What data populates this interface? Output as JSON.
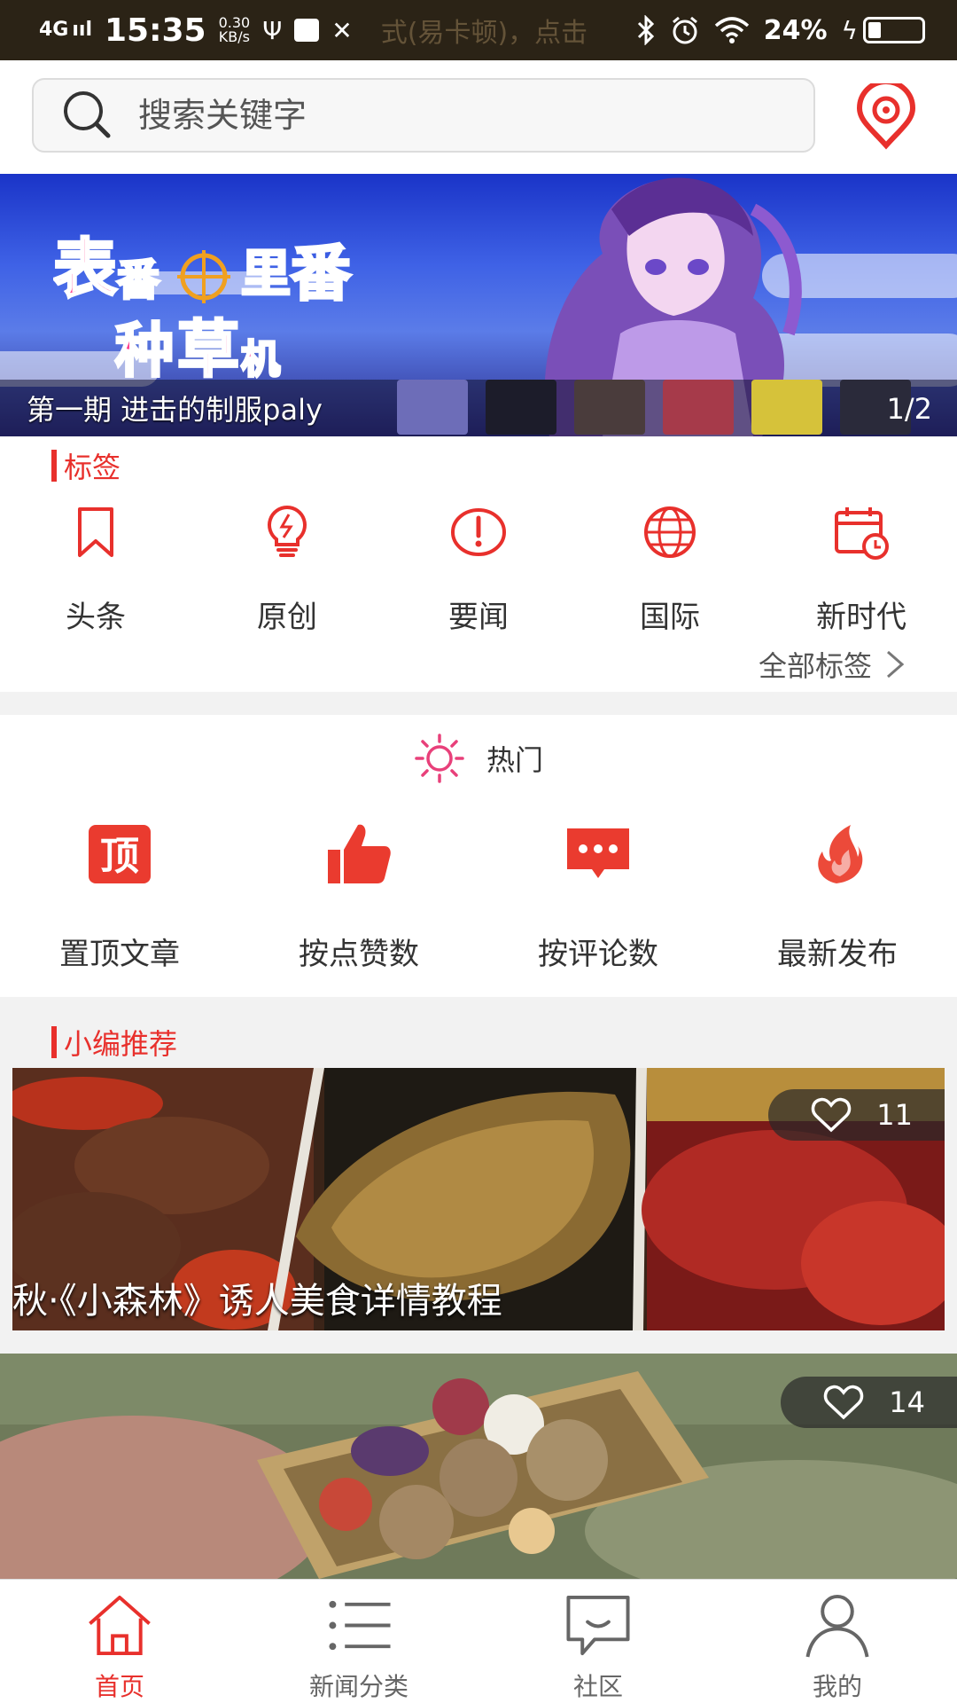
{
  "status_bar": {
    "network": "4G",
    "signal": "ııl",
    "time": "15:35",
    "speed_value": "0.30",
    "speed_unit": "KB/s",
    "ghost_text": "式(易卡顿)，点击",
    "battery_percent": "24%",
    "battery_level": 0.24,
    "icons": [
      "usb-icon",
      "notification-icon",
      "tools-icon",
      "bluetooth-icon",
      "alarm-icon",
      "wifi-icon",
      "charging-icon",
      "battery-icon"
    ]
  },
  "search": {
    "placeholder": "搜索关键字",
    "icon": "search-icon",
    "location_icon": "location-icon"
  },
  "banner": {
    "logo_text_1": "表",
    "logo_text_2": "番",
    "logo_text_3": "里",
    "logo_text_4": "番",
    "logo_text_5": "种",
    "logo_text_6": "草",
    "logo_text_7": "机",
    "caption": "第一期  进击的制服paly",
    "page_indicator": "1/2",
    "thumb_colors": [
      "#6d6db8",
      "#1c1c2a",
      "#4a3c3c",
      "#a63a4a",
      "#d6c23a",
      "#2a2a3a"
    ]
  },
  "tags": {
    "title": "标签",
    "items": [
      {
        "label": "头条",
        "icon": "bookmark-icon"
      },
      {
        "label": "原创",
        "icon": "lightbulb-icon"
      },
      {
        "label": "要闻",
        "icon": "exclamation-icon"
      },
      {
        "label": "国际",
        "icon": "globe-icon"
      },
      {
        "label": "新时代",
        "icon": "calendar-clock-icon"
      }
    ],
    "all_tags": "全部标签"
  },
  "hot": {
    "title": "热门",
    "items": [
      {
        "label": "置顶文章",
        "icon": "top-icon",
        "icon_text": "顶"
      },
      {
        "label": "按点赞数",
        "icon": "thumbs-up-icon"
      },
      {
        "label": "按评论数",
        "icon": "comment-icon"
      },
      {
        "label": "最新发布",
        "icon": "fire-icon"
      }
    ]
  },
  "recommend": {
    "title": "小编推荐",
    "cards": [
      {
        "caption": "秋·《小森林》诱人美食详情教程",
        "likes": "11"
      },
      {
        "caption": "",
        "likes": "14"
      }
    ]
  },
  "tabbar": {
    "active_color": "#e8302c",
    "items": [
      {
        "label": "首页",
        "icon": "home-icon",
        "active": true
      },
      {
        "label": "新闻分类",
        "icon": "list-icon",
        "active": false
      },
      {
        "label": "社区",
        "icon": "chat-icon",
        "active": false
      },
      {
        "label": "我的",
        "icon": "user-icon",
        "active": false
      }
    ]
  },
  "colors": {
    "accent": "#e8302c",
    "status_bar": "#2b2316"
  }
}
